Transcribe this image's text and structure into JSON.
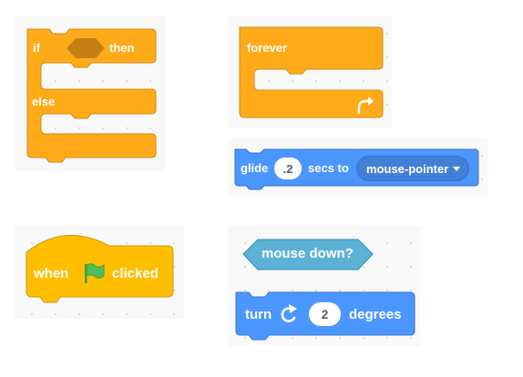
{
  "blocks": {
    "if_else": {
      "if_label": "if",
      "then_label": "then",
      "else_label": "else"
    },
    "forever": {
      "label": "forever",
      "icon": "loop-arrow-icon"
    },
    "glide": {
      "glide_label": "glide",
      "secs_value": ".2",
      "secs_label": "secs to",
      "target_value": "mouse-pointer",
      "dropdown_icon": "caret-down-icon"
    },
    "when_flag": {
      "when_label": "when",
      "flag_icon": "green-flag-icon",
      "clicked_label": "clicked"
    },
    "mouse_down": {
      "label": "mouse down?"
    },
    "turn": {
      "turn_label": "turn",
      "rotate_icon": "rotate-clockwise-icon",
      "degrees_value": "2",
      "degrees_label": "degrees"
    }
  },
  "colors": {
    "control": "#ffab19",
    "control_border": "#cf8b17",
    "events": "#ffbf00",
    "motion": "#4c97ff",
    "sensing": "#5cb1d6",
    "flag": "#4cbf56"
  }
}
